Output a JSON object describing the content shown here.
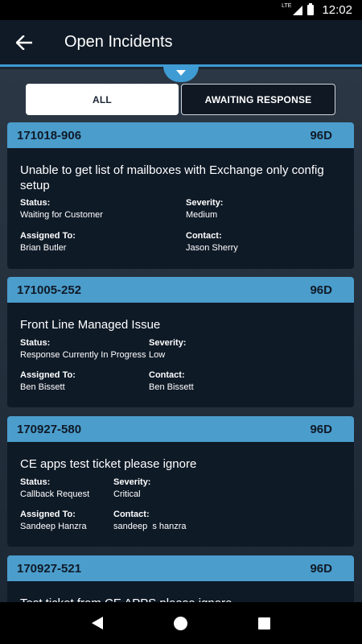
{
  "status_bar": {
    "network": "LTE",
    "time": "12:02"
  },
  "app_bar": {
    "title": "Open Incidents"
  },
  "tabs": [
    {
      "label": "ALL",
      "active": true
    },
    {
      "label": "AWAITING RESPONSE",
      "active": false
    }
  ],
  "labels": {
    "status": "Status:",
    "severity": "Severity:",
    "assigned_to": "Assigned To:",
    "contact": "Contact:"
  },
  "incidents": [
    {
      "id": "171018-906",
      "age": "96D",
      "title": "Unable to get list of mailboxes with Exchange only config setup",
      "status": "Waiting for Customer",
      "severity": "Medium",
      "assigned_to": "Brian Butler",
      "contact": "Jason Sherry"
    },
    {
      "id": "171005-252",
      "age": "96D",
      "title": "Front Line Managed Issue",
      "status": "Response Currently In Progress",
      "severity": "Low",
      "assigned_to": "Ben Bissett",
      "contact": "Ben Bissett"
    },
    {
      "id": "170927-580",
      "age": "96D",
      "title": "CE apps test ticket please ignore",
      "status": "Callback Request",
      "severity": "Critical",
      "assigned_to": "Sandeep Hanzra",
      "contact": "sandeep  s hanzra"
    },
    {
      "id": "170927-521",
      "age": "96D",
      "title": "Test ticket from CE APPS please ignore"
    }
  ],
  "colors": {
    "accent": "#4b9dcc",
    "card_bg": "#0f1a27",
    "app_bar": "#101a26"
  },
  "icons": {
    "back": "arrow-left-icon",
    "expand": "chevron-down-icon"
  }
}
